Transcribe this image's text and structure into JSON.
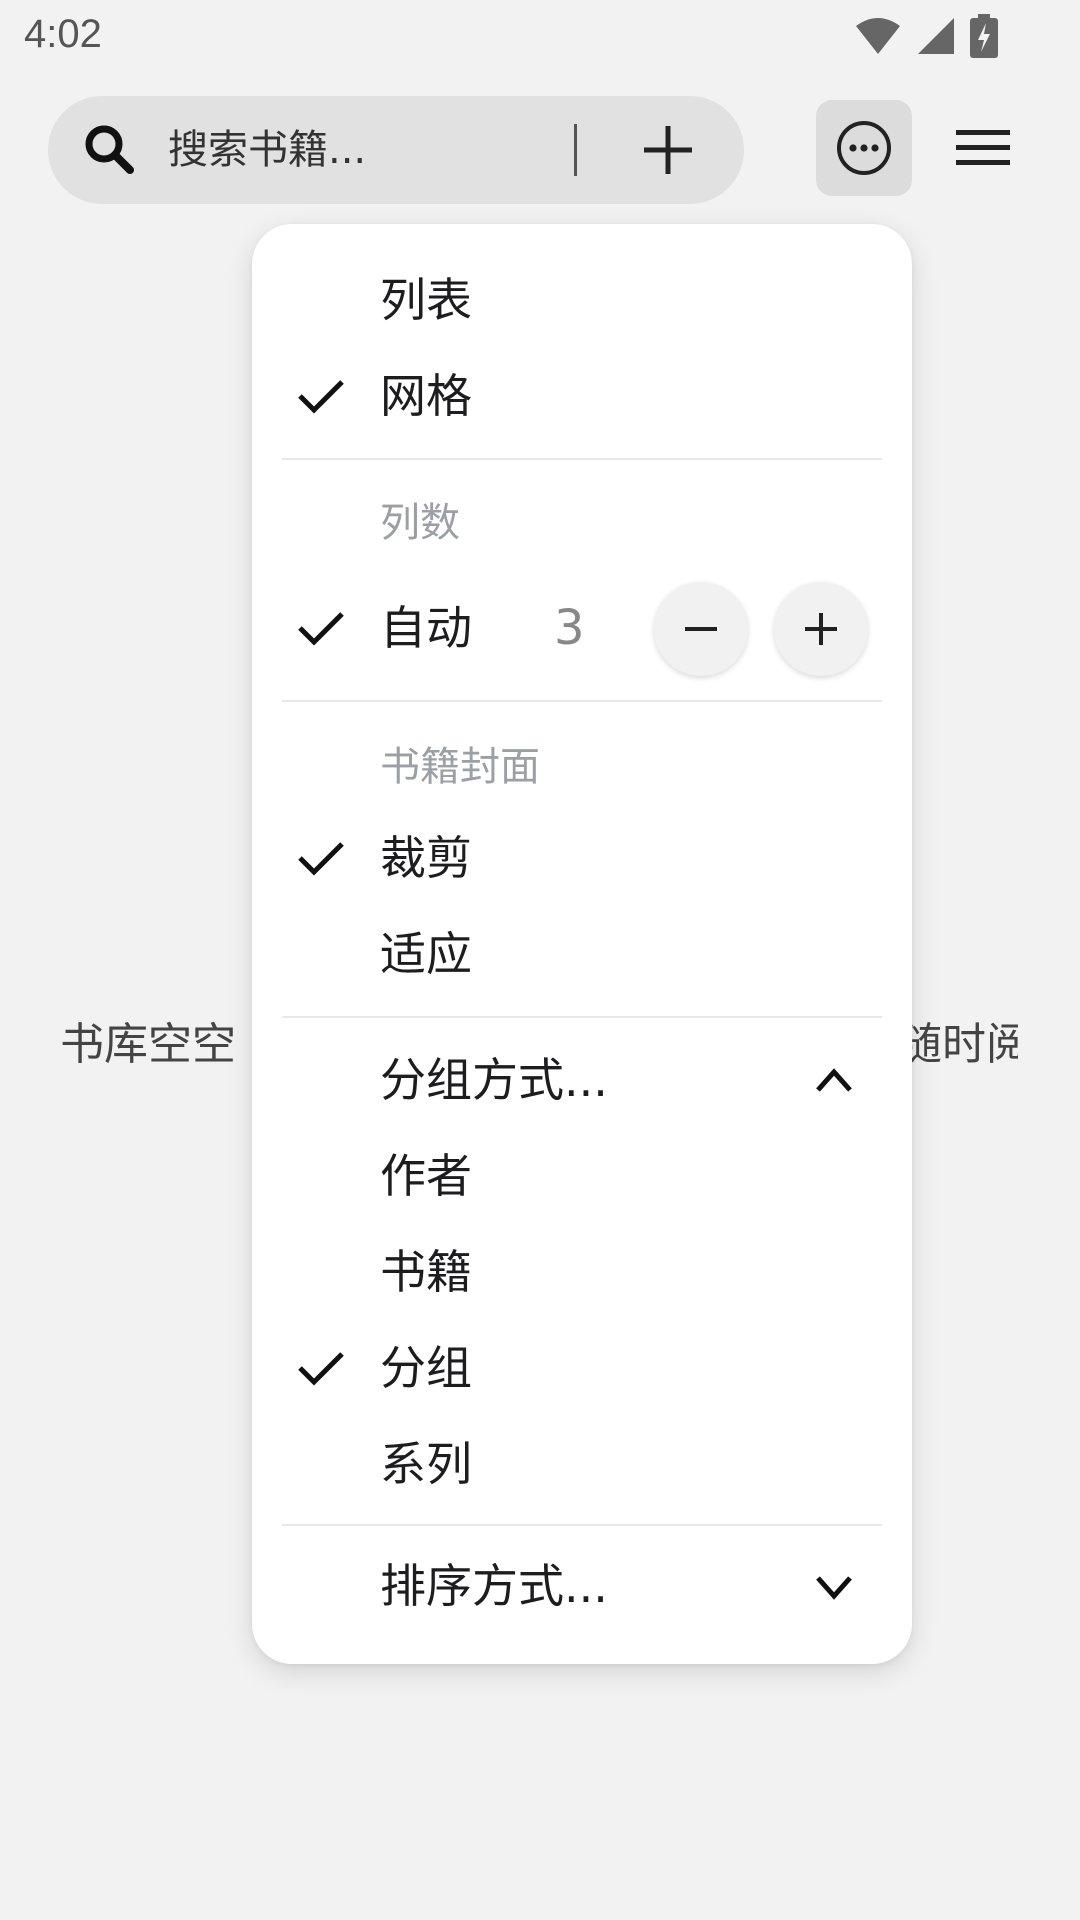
{
  "status": {
    "time": "4:02"
  },
  "search": {
    "placeholder": "搜索书籍..."
  },
  "background": {
    "left_text": "书库空空",
    "right_text": "随时阅"
  },
  "menu": {
    "view_list": "列表",
    "view_grid": "网格",
    "columns_title": "列数",
    "columns_auto": "自动",
    "columns_value": "3",
    "cover_title": "书籍封面",
    "cover_crop": "裁剪",
    "cover_fit": "适应",
    "group_by": "分组方式...",
    "group_author": "作者",
    "group_book": "书籍",
    "group_group": "分组",
    "group_series": "系列",
    "sort_by": "排序方式..."
  }
}
